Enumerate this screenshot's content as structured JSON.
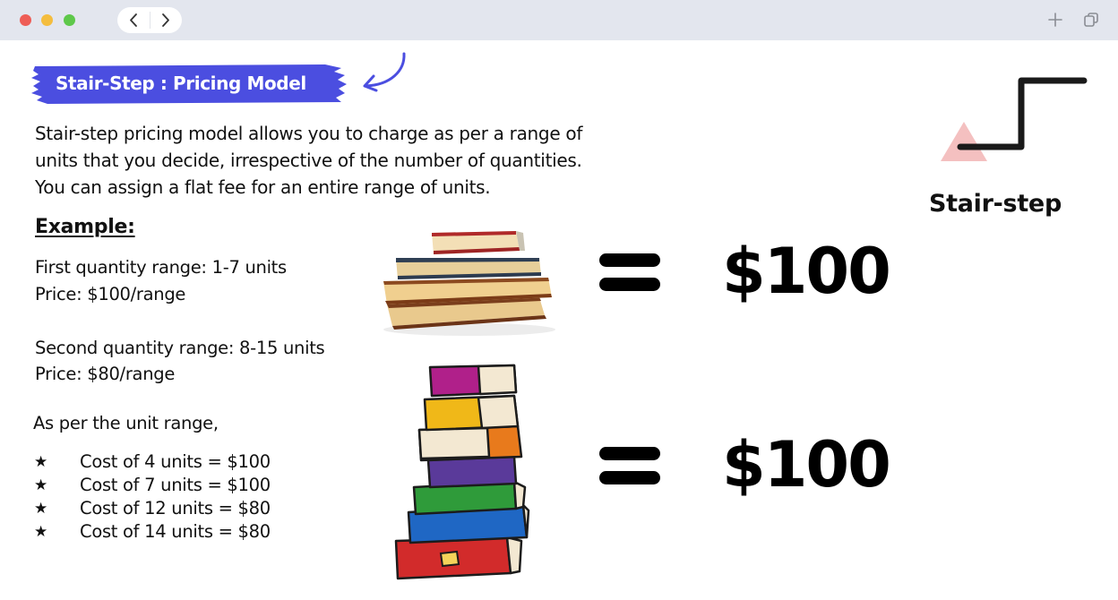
{
  "browser": {
    "back_icon": "chevron-left-icon",
    "forward_icon": "chevron-right-icon",
    "new_tab_icon": "plus-icon",
    "window_icon": "copy-icon",
    "traffic_lights": [
      "#ee5d56",
      "#f4bd3e",
      "#5ec84a"
    ]
  },
  "slide": {
    "title": "Stair-Step : Pricing Model",
    "title_color": "#4b4ee0",
    "description_lines": [
      "Stair-step pricing model allows you to charge as per a range of",
      "units that you decide, irrespective of the number of quantities.",
      "You can assign a flat fee for an entire range of units."
    ],
    "example_heading": "Example:",
    "first_range": "First quantity range: 1-7 units",
    "first_price": "Price: $100/range",
    "second_range": "Second quantity range: 8-15 units",
    "second_price": "Price: $80/range",
    "as_per": "As per the unit range,",
    "bullet_symbol": "★",
    "bullets": [
      "Cost of 4 units = $100",
      "Cost of 7 units = $100",
      "Cost of 12 units = $80",
      "Cost of 14 units = $80"
    ],
    "equations": [
      {
        "left": "small-book-stack",
        "value": "$100"
      },
      {
        "left": "tall-book-stack",
        "value": "$100"
      }
    ],
    "stair_label": "Stair-step"
  }
}
